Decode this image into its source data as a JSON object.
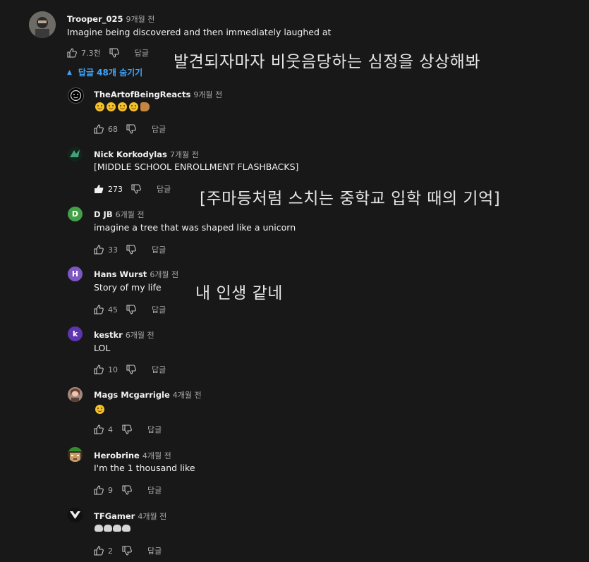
{
  "top_comment": {
    "author": "Trooper_025",
    "time": "9개월 전",
    "text": "Imagine being discovered and then immediately laughed at",
    "likes": "7.3천",
    "reply_label": "답글",
    "replies_toggle": "답글 48개 숨기기"
  },
  "overlays": {
    "caption1": "발견되자마자 비웃음당하는 심정을 상상해봐",
    "caption2": "[주마등처럼 스치는 중학교 입학 때의 기억]",
    "caption3": "내 인생 같네"
  },
  "replies": [
    {
      "author": "TheArtofBeingReacts",
      "time": "9개월 전",
      "text": "",
      "likes": "68",
      "reply_label": "답글",
      "avatar_letter": "",
      "avatar_color": "#000000"
    },
    {
      "author": "Nick Korkodylas",
      "time": "7개월 전",
      "text": "[MIDDLE SCHOOL ENROLLMENT FLASHBACKS]",
      "likes": "273",
      "reply_label": "답글",
      "avatar_letter": "",
      "avatar_color": "#1f3a2e"
    },
    {
      "author": "D JB",
      "time": "6개월 전",
      "text": "imagine a tree that was shaped like a unicorn",
      "likes": "33",
      "reply_label": "답글",
      "avatar_letter": "D",
      "avatar_color": "#43a047"
    },
    {
      "author": "Hans Wurst",
      "time": "6개월 전",
      "text": "Story of my life",
      "likes": "45",
      "reply_label": "답글",
      "avatar_letter": "H",
      "avatar_color": "#7e57c2"
    },
    {
      "author": "kestkr",
      "time": "6개월 전",
      "text": "LOL",
      "likes": "10",
      "reply_label": "답글",
      "avatar_letter": "k",
      "avatar_color": "#5e35b1"
    },
    {
      "author": "Mags Mcgarrigle",
      "time": "4개월 전",
      "text": "",
      "likes": "4",
      "reply_label": "답글",
      "avatar_letter": "",
      "avatar_color": "#8d6e63"
    },
    {
      "author": "Herobrine",
      "time": "4개월 전",
      "text": "I'm the 1 thousand like",
      "likes": "9",
      "reply_label": "답글",
      "avatar_letter": "",
      "avatar_color": "#4e6b3a"
    },
    {
      "author": "TFGamer",
      "time": "4개월 전",
      "text": "",
      "likes": "2",
      "reply_label": "답글",
      "avatar_letter": "",
      "avatar_color": "#000000"
    }
  ]
}
